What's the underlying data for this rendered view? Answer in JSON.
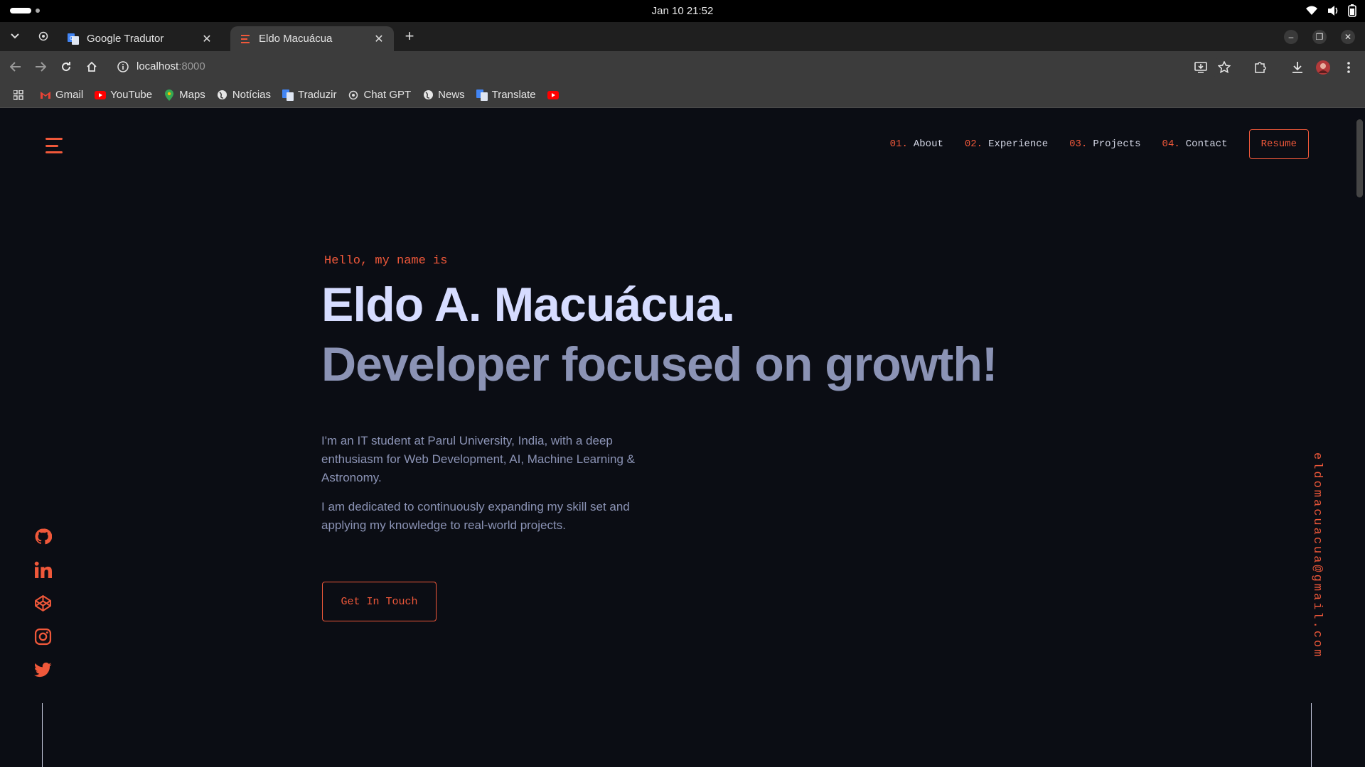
{
  "os": {
    "clock": "Jan 10  21:52"
  },
  "browser": {
    "tabs": [
      {
        "title": "Google Tradutor"
      },
      {
        "title": "Eldo Macuácua"
      }
    ],
    "url": {
      "host": "localhost",
      "port": ":8000"
    },
    "bookmarks": [
      {
        "label": "Gmail",
        "icon": "gmail-icon"
      },
      {
        "label": "YouTube",
        "icon": "youtube-icon"
      },
      {
        "label": "Maps",
        "icon": "maps-icon"
      },
      {
        "label": "Notícias",
        "icon": "globe-icon"
      },
      {
        "label": "Traduzir",
        "icon": "translate-icon"
      },
      {
        "label": "Chat GPT",
        "icon": "openai-icon"
      },
      {
        "label": "News",
        "icon": "globe-icon"
      },
      {
        "label": "Translate",
        "icon": "translate-icon"
      }
    ]
  },
  "site": {
    "accent": "#f0583a",
    "nav": [
      {
        "num": "01.",
        "label": "About"
      },
      {
        "num": "02.",
        "label": "Experience"
      },
      {
        "num": "03.",
        "label": "Projects"
      },
      {
        "num": "04.",
        "label": "Contact"
      }
    ],
    "resume_label": "Resume",
    "hero": {
      "greeting": "Hello, my name is",
      "name": "Eldo A. Macuácua.",
      "tagline": "Developer focused on growth!",
      "bio_1": "I'm an IT student at Parul University, India, with a deep enthusiasm for Web Development, AI, Machine Learning & Astronomy.",
      "bio_2": "I am dedicated to continuously expanding my skill set and applying my knowledge to real-world projects.",
      "cta_label": "Get In Touch"
    },
    "socials": [
      "github-icon",
      "linkedin-icon",
      "codepen-icon",
      "instagram-icon",
      "twitter-icon"
    ],
    "email": "eldomacuacua@gmail.com"
  }
}
